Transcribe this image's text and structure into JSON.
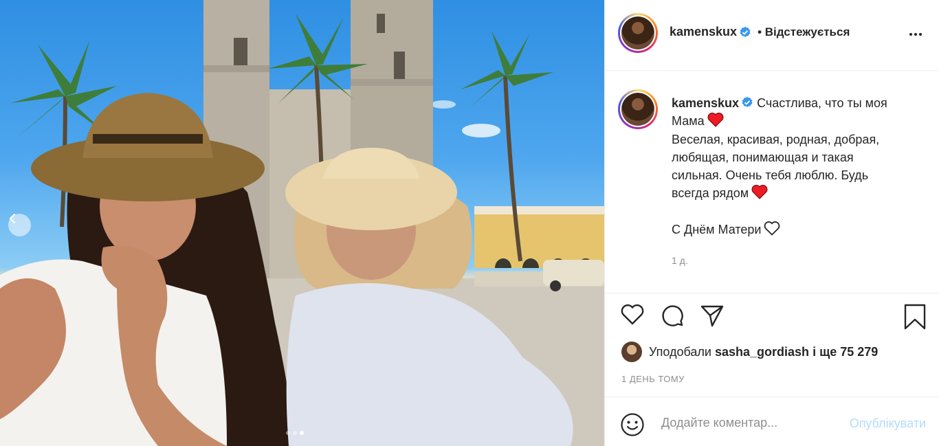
{
  "colors": {
    "brand_blue": "#0095f6",
    "publish_disabled": "#b3dbff",
    "heart_red": "#ed4956",
    "muted": "#8e8e8e",
    "text": "#262626"
  },
  "photo": {
    "carousel_total": 3,
    "carousel_active": 3
  },
  "header": {
    "username": "kamenskux",
    "follow_status": "• Відстежується",
    "more_icon": "more-horizontal-icon"
  },
  "caption": {
    "username": "kamenskux",
    "lines": [
      "Счастлива, что ты моя",
      "Мама",
      "Веселая, красивая, родная, добрая,",
      "любящая, понимающая и такая",
      "сильная. Очень тебя люблю. Будь",
      "всегда рядом",
      "С Днём Матери"
    ],
    "time": "1 д."
  },
  "actions": {
    "like_icon": "heart-outline-icon",
    "comment_icon": "comment-icon",
    "share_icon": "paper-plane-icon",
    "save_icon": "bookmark-icon"
  },
  "likes": {
    "prefix": "Уподобали",
    "user": "sasha_gordiash",
    "suffix": "і ще 75 279"
  },
  "date": "1 ДЕНЬ ТОМУ",
  "comment": {
    "placeholder": "Додайте коментар...",
    "publish": "Опублікувати"
  }
}
